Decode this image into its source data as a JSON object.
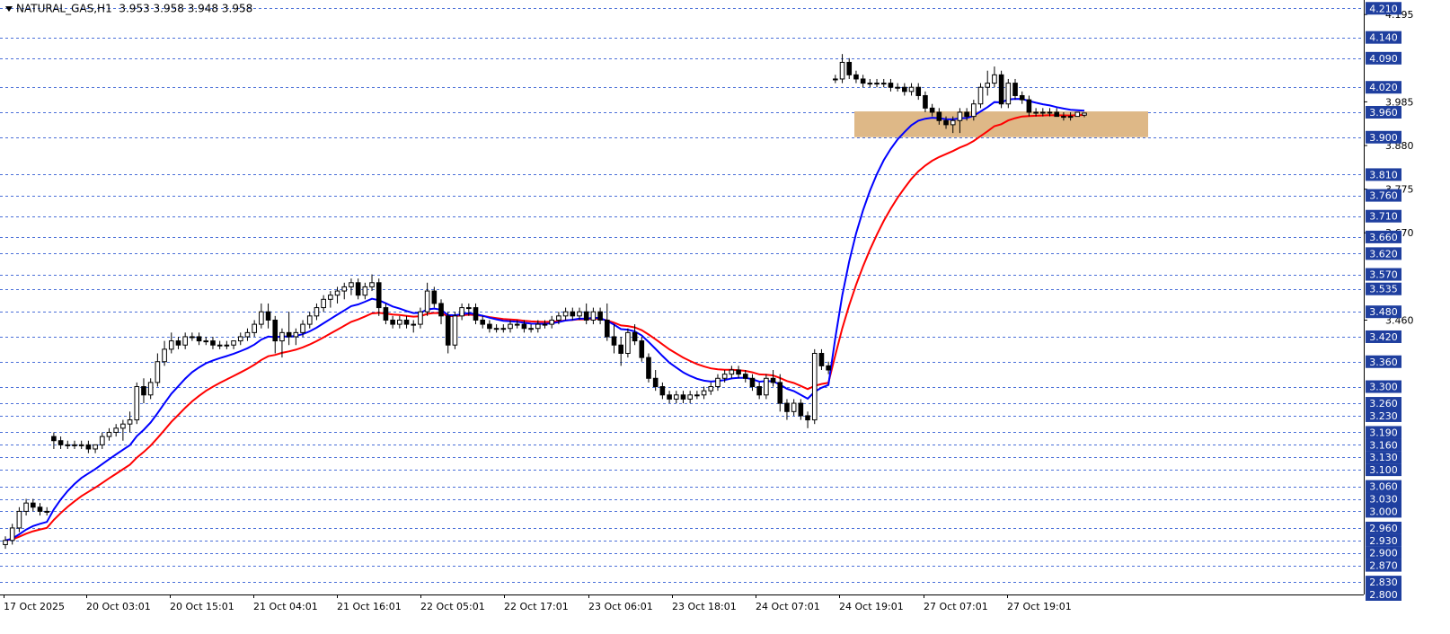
{
  "header": {
    "symbol": "NATURAL_GAS,H1",
    "ohlc": "3.953 3.958 3.948 3.958"
  },
  "chart_data": {
    "type": "candlestick",
    "title": "NATURAL_GAS,H1",
    "ylim": [
      2.8,
      4.23
    ],
    "grid": true,
    "x_tick_labels": [
      "17 Oct 2025",
      "20 Oct 03:01",
      "20 Oct 15:01",
      "21 Oct 04:01",
      "21 Oct 16:01",
      "22 Oct 05:01",
      "22 Oct 17:01",
      "23 Oct 06:01",
      "23 Oct 18:01",
      "24 Oct 07:01",
      "24 Oct 19:01",
      "27 Oct 07:01",
      "27 Oct 19:01"
    ],
    "price_levels": [
      "4.210",
      "4.140",
      "4.090",
      "4.020",
      "3.960",
      "3.900",
      "3.810",
      "3.760",
      "3.710",
      "3.660",
      "3.620",
      "3.570",
      "3.535",
      "3.480",
      "3.420",
      "3.360",
      "3.300",
      "3.260",
      "3.230",
      "3.190",
      "3.160",
      "3.130",
      "3.100",
      "3.060",
      "3.030",
      "3.000",
      "2.960",
      "2.930",
      "2.900",
      "2.870",
      "2.830",
      "2.800"
    ],
    "minor_axis_labels": [
      "4.195",
      "3.985",
      "3.880",
      "3.775",
      "3.670",
      "3.460"
    ],
    "zone": {
      "from": 3.9,
      "to": 3.962,
      "color": "#deb887"
    },
    "colors": {
      "fast_ma": "#0000ff",
      "slow_ma": "#ff0000",
      "grid": "#4a6fd8",
      "label_bg": "#1f3f9f"
    },
    "candles": [
      [
        2.92,
        2.94,
        2.91,
        2.93
      ],
      [
        2.93,
        2.97,
        2.92,
        2.96
      ],
      [
        2.96,
        3.01,
        2.95,
        3.0
      ],
      [
        3.0,
        3.03,
        2.99,
        3.02
      ],
      [
        3.02,
        3.03,
        3.0,
        3.01
      ],
      [
        3.01,
        3.02,
        2.99,
        3.0
      ],
      [
        3.0,
        3.01,
        2.99,
        3.0
      ],
      [
        3.18,
        3.19,
        3.15,
        3.17
      ],
      [
        3.17,
        3.18,
        3.15,
        3.16
      ],
      [
        3.16,
        3.17,
        3.15,
        3.16
      ],
      [
        3.16,
        3.17,
        3.15,
        3.16
      ],
      [
        3.16,
        3.17,
        3.15,
        3.16
      ],
      [
        3.16,
        3.17,
        3.14,
        3.15
      ],
      [
        3.15,
        3.16,
        3.14,
        3.16
      ],
      [
        3.16,
        3.19,
        3.15,
        3.18
      ],
      [
        3.18,
        3.2,
        3.17,
        3.19
      ],
      [
        3.19,
        3.21,
        3.18,
        3.2
      ],
      [
        3.2,
        3.22,
        3.17,
        3.21
      ],
      [
        3.21,
        3.24,
        3.19,
        3.22
      ],
      [
        3.22,
        3.31,
        3.21,
        3.3
      ],
      [
        3.3,
        3.32,
        3.26,
        3.28
      ],
      [
        3.28,
        3.32,
        3.27,
        3.31
      ],
      [
        3.31,
        3.38,
        3.3,
        3.36
      ],
      [
        3.36,
        3.41,
        3.35,
        3.39
      ],
      [
        3.39,
        3.43,
        3.38,
        3.41
      ],
      [
        3.41,
        3.42,
        3.39,
        3.4
      ],
      [
        3.4,
        3.43,
        3.39,
        3.42
      ],
      [
        3.42,
        3.43,
        3.41,
        3.42
      ],
      [
        3.42,
        3.43,
        3.4,
        3.41
      ],
      [
        3.41,
        3.42,
        3.4,
        3.41
      ],
      [
        3.41,
        3.42,
        3.39,
        3.4
      ],
      [
        3.4,
        3.41,
        3.39,
        3.4
      ],
      [
        3.4,
        3.41,
        3.39,
        3.4
      ],
      [
        3.4,
        3.41,
        3.39,
        3.41
      ],
      [
        3.41,
        3.43,
        3.4,
        3.42
      ],
      [
        3.42,
        3.44,
        3.41,
        3.43
      ],
      [
        3.43,
        3.46,
        3.42,
        3.45
      ],
      [
        3.45,
        3.5,
        3.44,
        3.48
      ],
      [
        3.48,
        3.5,
        3.44,
        3.46
      ],
      [
        3.46,
        3.47,
        3.38,
        3.41
      ],
      [
        3.41,
        3.44,
        3.37,
        3.43
      ],
      [
        3.43,
        3.48,
        3.4,
        3.42
      ],
      [
        3.42,
        3.44,
        3.4,
        3.43
      ],
      [
        3.43,
        3.46,
        3.42,
        3.45
      ],
      [
        3.45,
        3.48,
        3.44,
        3.47
      ],
      [
        3.47,
        3.5,
        3.46,
        3.49
      ],
      [
        3.49,
        3.52,
        3.48,
        3.51
      ],
      [
        3.51,
        3.53,
        3.49,
        3.52
      ],
      [
        3.52,
        3.54,
        3.5,
        3.53
      ],
      [
        3.53,
        3.55,
        3.51,
        3.54
      ],
      [
        3.54,
        3.56,
        3.52,
        3.55
      ],
      [
        3.55,
        3.56,
        3.51,
        3.52
      ],
      [
        3.52,
        3.55,
        3.51,
        3.54
      ],
      [
        3.54,
        3.57,
        3.53,
        3.55
      ],
      [
        3.55,
        3.56,
        3.47,
        3.49
      ],
      [
        3.49,
        3.5,
        3.45,
        3.46
      ],
      [
        3.46,
        3.47,
        3.44,
        3.45
      ],
      [
        3.45,
        3.47,
        3.44,
        3.46
      ],
      [
        3.46,
        3.47,
        3.44,
        3.45
      ],
      [
        3.45,
        3.46,
        3.43,
        3.45
      ],
      [
        3.45,
        3.49,
        3.44,
        3.48
      ],
      [
        3.48,
        3.55,
        3.47,
        3.53
      ],
      [
        3.53,
        3.54,
        3.49,
        3.5
      ],
      [
        3.5,
        3.51,
        3.45,
        3.47
      ],
      [
        3.47,
        3.48,
        3.38,
        3.4
      ],
      [
        3.4,
        3.48,
        3.39,
        3.47
      ],
      [
        3.47,
        3.5,
        3.46,
        3.49
      ],
      [
        3.49,
        3.5,
        3.47,
        3.49
      ],
      [
        3.49,
        3.5,
        3.45,
        3.46
      ],
      [
        3.46,
        3.47,
        3.44,
        3.45
      ],
      [
        3.45,
        3.46,
        3.43,
        3.44
      ],
      [
        3.44,
        3.45,
        3.43,
        3.44
      ],
      [
        3.44,
        3.45,
        3.43,
        3.44
      ],
      [
        3.44,
        3.46,
        3.43,
        3.45
      ],
      [
        3.45,
        3.46,
        3.44,
        3.45
      ],
      [
        3.45,
        3.46,
        3.43,
        3.44
      ],
      [
        3.44,
        3.45,
        3.43,
        3.44
      ],
      [
        3.44,
        3.46,
        3.43,
        3.45
      ],
      [
        3.45,
        3.46,
        3.44,
        3.45
      ],
      [
        3.45,
        3.47,
        3.44,
        3.46
      ],
      [
        3.46,
        3.48,
        3.45,
        3.47
      ],
      [
        3.47,
        3.49,
        3.46,
        3.48
      ],
      [
        3.48,
        3.49,
        3.46,
        3.47
      ],
      [
        3.47,
        3.49,
        3.46,
        3.48
      ],
      [
        3.48,
        3.5,
        3.45,
        3.46
      ],
      [
        3.46,
        3.49,
        3.45,
        3.48
      ],
      [
        3.48,
        3.49,
        3.45,
        3.46
      ],
      [
        3.46,
        3.5,
        3.41,
        3.42
      ],
      [
        3.42,
        3.45,
        3.38,
        3.4
      ],
      [
        3.4,
        3.42,
        3.35,
        3.38
      ],
      [
        3.38,
        3.44,
        3.37,
        3.43
      ],
      [
        3.43,
        3.45,
        3.4,
        3.41
      ],
      [
        3.41,
        3.42,
        3.36,
        3.37
      ],
      [
        3.37,
        3.38,
        3.31,
        3.32
      ],
      [
        3.32,
        3.34,
        3.29,
        3.3
      ],
      [
        3.3,
        3.31,
        3.27,
        3.28
      ],
      [
        3.28,
        3.29,
        3.26,
        3.27
      ],
      [
        3.27,
        3.29,
        3.26,
        3.28
      ],
      [
        3.28,
        3.29,
        3.26,
        3.27
      ],
      [
        3.27,
        3.29,
        3.26,
        3.28
      ],
      [
        3.28,
        3.29,
        3.27,
        3.28
      ],
      [
        3.28,
        3.3,
        3.27,
        3.29
      ],
      [
        3.29,
        3.31,
        3.28,
        3.3
      ],
      [
        3.3,
        3.33,
        3.29,
        3.32
      ],
      [
        3.32,
        3.34,
        3.31,
        3.33
      ],
      [
        3.33,
        3.35,
        3.32,
        3.34
      ],
      [
        3.34,
        3.35,
        3.32,
        3.33
      ],
      [
        3.33,
        3.34,
        3.31,
        3.32
      ],
      [
        3.32,
        3.33,
        3.29,
        3.3
      ],
      [
        3.3,
        3.31,
        3.27,
        3.28
      ],
      [
        3.28,
        3.33,
        3.27,
        3.32
      ],
      [
        3.32,
        3.34,
        3.3,
        3.31
      ],
      [
        3.31,
        3.33,
        3.24,
        3.26
      ],
      [
        3.26,
        3.27,
        3.22,
        3.24
      ],
      [
        3.24,
        3.27,
        3.23,
        3.26
      ],
      [
        3.26,
        3.27,
        3.22,
        3.23
      ],
      [
        3.23,
        3.24,
        3.2,
        3.22
      ],
      [
        3.22,
        3.39,
        3.21,
        3.38
      ],
      [
        3.38,
        3.39,
        3.34,
        3.35
      ],
      [
        3.35,
        3.36,
        3.33,
        3.34
      ],
      [
        4.04,
        4.05,
        4.03,
        4.04
      ],
      [
        4.04,
        4.1,
        4.03,
        4.08
      ],
      [
        4.08,
        4.09,
        4.04,
        4.05
      ],
      [
        4.05,
        4.06,
        4.03,
        4.04
      ],
      [
        4.04,
        4.05,
        4.02,
        4.03
      ],
      [
        4.03,
        4.04,
        4.02,
        4.03
      ],
      [
        4.03,
        4.04,
        4.02,
        4.03
      ],
      [
        4.03,
        4.04,
        4.02,
        4.03
      ],
      [
        4.03,
        4.04,
        4.01,
        4.02
      ],
      [
        4.02,
        4.03,
        4.01,
        4.02
      ],
      [
        4.02,
        4.03,
        4.0,
        4.01
      ],
      [
        4.01,
        4.03,
        4.0,
        4.02
      ],
      [
        4.02,
        4.03,
        3.99,
        4.0
      ],
      [
        4.0,
        4.01,
        3.96,
        3.97
      ],
      [
        3.97,
        3.98,
        3.95,
        3.96
      ],
      [
        3.96,
        3.97,
        3.93,
        3.94
      ],
      [
        3.94,
        3.95,
        3.92,
        3.93
      ],
      [
        3.93,
        3.95,
        3.91,
        3.94
      ],
      [
        3.94,
        3.97,
        3.91,
        3.96
      ],
      [
        3.96,
        3.97,
        3.94,
        3.95
      ],
      [
        3.95,
        3.99,
        3.94,
        3.98
      ],
      [
        3.98,
        4.03,
        3.97,
        4.02
      ],
      [
        4.02,
        4.06,
        4.0,
        4.03
      ],
      [
        4.03,
        4.07,
        4.02,
        4.05
      ],
      [
        4.05,
        4.06,
        3.97,
        3.98
      ],
      [
        3.98,
        4.04,
        3.97,
        4.03
      ],
      [
        4.03,
        4.04,
        3.99,
        4.0
      ],
      [
        4.0,
        4.01,
        3.98,
        3.99
      ],
      [
        3.99,
        4.0,
        3.95,
        3.96
      ],
      [
        3.96,
        3.97,
        3.95,
        3.96
      ],
      [
        3.96,
        3.97,
        3.95,
        3.96
      ],
      [
        3.96,
        3.97,
        3.95,
        3.96
      ],
      [
        3.96,
        3.97,
        3.95,
        3.95
      ],
      [
        3.95,
        3.96,
        3.94,
        3.95
      ],
      [
        3.95,
        3.96,
        3.94,
        3.95
      ],
      [
        3.95,
        3.96,
        3.95,
        3.96
      ],
      [
        3.953,
        3.958,
        3.948,
        3.958
      ]
    ]
  }
}
